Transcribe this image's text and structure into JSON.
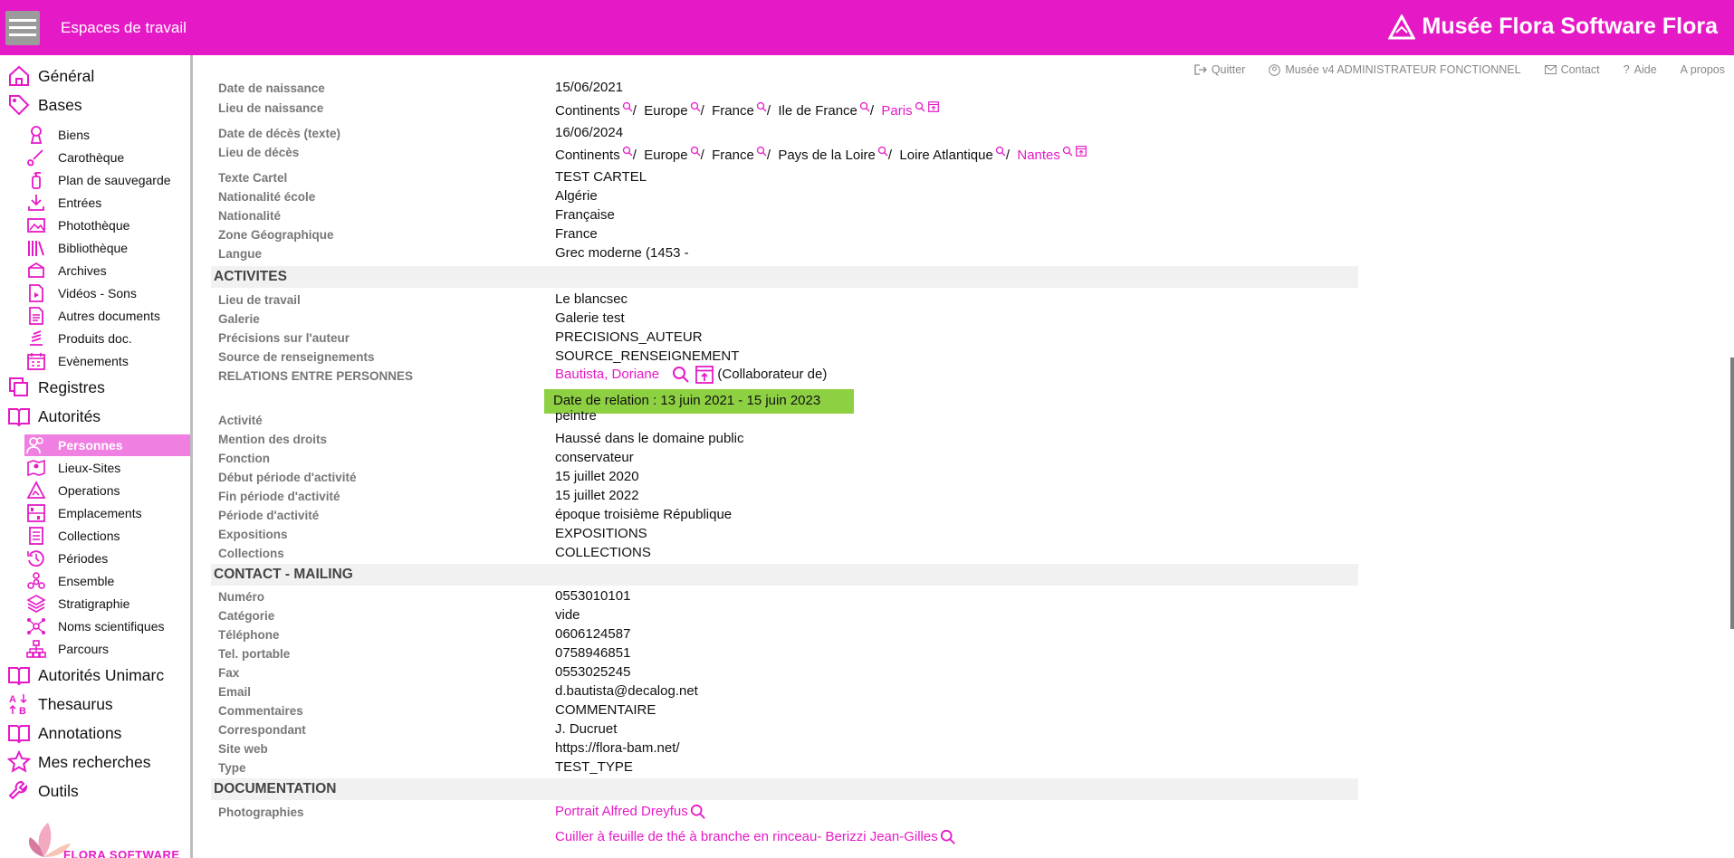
{
  "topbar": {
    "workspace": "Espaces de travail",
    "brand": "Musée Flora Software Flora",
    "menu_icon": "hamburger-menu-icon",
    "brand_icon": "flora-logo-icon"
  },
  "toplinks": {
    "quit": "Quitter",
    "user": "Musée v4 ADMINISTRATEUR FONCTIONNEL",
    "contact": "Contact",
    "help": "Aide",
    "about": "A propos"
  },
  "sidebar": {
    "general": "Général",
    "bases": "Bases",
    "bases_items": [
      "Biens",
      "Carothèque",
      "Plan de sauvegarde",
      "Entrées",
      "Photothèque",
      "Bibliothèque",
      "Archives",
      "Vidéos - Sons",
      "Autres documents",
      "Produits doc.",
      "Evènements"
    ],
    "registres": "Registres",
    "autorites": "Autorités",
    "autorites_items": [
      "Personnes",
      "Lieux-Sites",
      "Operations",
      "Emplacements",
      "Collections",
      "Périodes",
      "Ensemble",
      "Stratigraphie",
      "Noms scientifiques",
      "Parcours"
    ],
    "autorites_unimarc": "Autorités Unimarc",
    "thesaurus": "Thesaurus",
    "annotations": "Annotations",
    "mes_recherches": "Mes recherches",
    "outils": "Outils",
    "logo_text": "FLORA SOFTWARE"
  },
  "fields": {
    "date_naissance": {
      "label": "Date de naissance",
      "value": "15/06/2021"
    },
    "lieu_naissance": {
      "label": "Lieu de naissance",
      "path": [
        "Continents",
        "Europe",
        "France",
        "Ile de France"
      ],
      "leaf": "Paris"
    },
    "date_deces_texte": {
      "label": "Date de décès (texte)",
      "value": "16/06/2024"
    },
    "lieu_deces": {
      "label": "Lieu de décès",
      "path": [
        "Continents",
        "Europe",
        "France",
        "Pays de la Loire",
        "Loire Atlantique"
      ],
      "leaf": "Nantes"
    },
    "texte_cartel": {
      "label": "Texte Cartel",
      "value": "TEST CARTEL"
    },
    "nationalite_ecole": {
      "label": "Nationalité école",
      "value": "Algérie"
    },
    "nationalite": {
      "label": "Nationalité",
      "value": "Française"
    },
    "zone_geo": {
      "label": "Zone Géographique",
      "value": "France"
    },
    "langue": {
      "label": "Langue",
      "value": "Grec moderne (1453 -"
    }
  },
  "activites": {
    "title": "ACTIVITES",
    "lieu_travail": {
      "label": "Lieu de travail",
      "value": "Le blancsec"
    },
    "galerie": {
      "label": "Galerie",
      "value": "Galerie test"
    },
    "precisions": {
      "label": "Précisions sur l'auteur",
      "value": "PRECISIONS_AUTEUR"
    },
    "source": {
      "label": "Source de renseignements",
      "value": "SOURCE_RENSEIGNEMENT"
    },
    "relations": {
      "label": "RELATIONS ENTRE PERSONNES",
      "person": "Bautista, Doriane",
      "role": "(Collaborateur de)",
      "tooltip": "Date de relation : 13 juin 2021 - 15 juin 2023"
    },
    "activite": {
      "label": "Activité",
      "value": "peintre"
    },
    "mention": {
      "label": "Mention des droits",
      "value": "Haussé dans le domaine public"
    },
    "fonction": {
      "label": "Fonction",
      "value": "conservateur"
    },
    "debut": {
      "label": "Début période d'activité",
      "value": "15 juillet 2020"
    },
    "fin": {
      "label": "Fin période d'activité",
      "value": "15 juillet 2022"
    },
    "periode": {
      "label": "Période d'activité",
      "value": "époque troisième République"
    },
    "expositions": {
      "label": "Expositions",
      "value": "EXPOSITIONS"
    },
    "collections": {
      "label": "Collections",
      "value": "COLLECTIONS"
    }
  },
  "contact": {
    "title": "CONTACT - MAILING",
    "numero": {
      "label": "Numéro",
      "value": "0553010101"
    },
    "categorie": {
      "label": "Catégorie",
      "value": "vide"
    },
    "telephone": {
      "label": "Téléphone",
      "value": "0606124587"
    },
    "portable": {
      "label": "Tel. portable",
      "value": "0758946851"
    },
    "fax": {
      "label": "Fax",
      "value": "0553025245"
    },
    "email": {
      "label": "Email",
      "value": "d.bautista@decalog.net"
    },
    "commentaires": {
      "label": "Commentaires",
      "value": "COMMENTAIRE"
    },
    "correspondant": {
      "label": "Correspondant",
      "value": "J. Ducruet"
    },
    "site_web": {
      "label": "Site web",
      "value": "https://flora-bam.net/"
    },
    "type": {
      "label": "Type",
      "value": "TEST_TYPE"
    }
  },
  "documentation": {
    "title": "DOCUMENTATION",
    "photographies": {
      "label": "Photographies",
      "items": [
        "Portrait Alfred Dreyfus",
        "Cuiller à feuille de thé à branche en rinceau- Berizzi Jean-Gilles"
      ]
    }
  },
  "colors": {
    "accent": "#e619c7",
    "tooltip": "#8dd142",
    "active_nav": "#f07fe2"
  }
}
